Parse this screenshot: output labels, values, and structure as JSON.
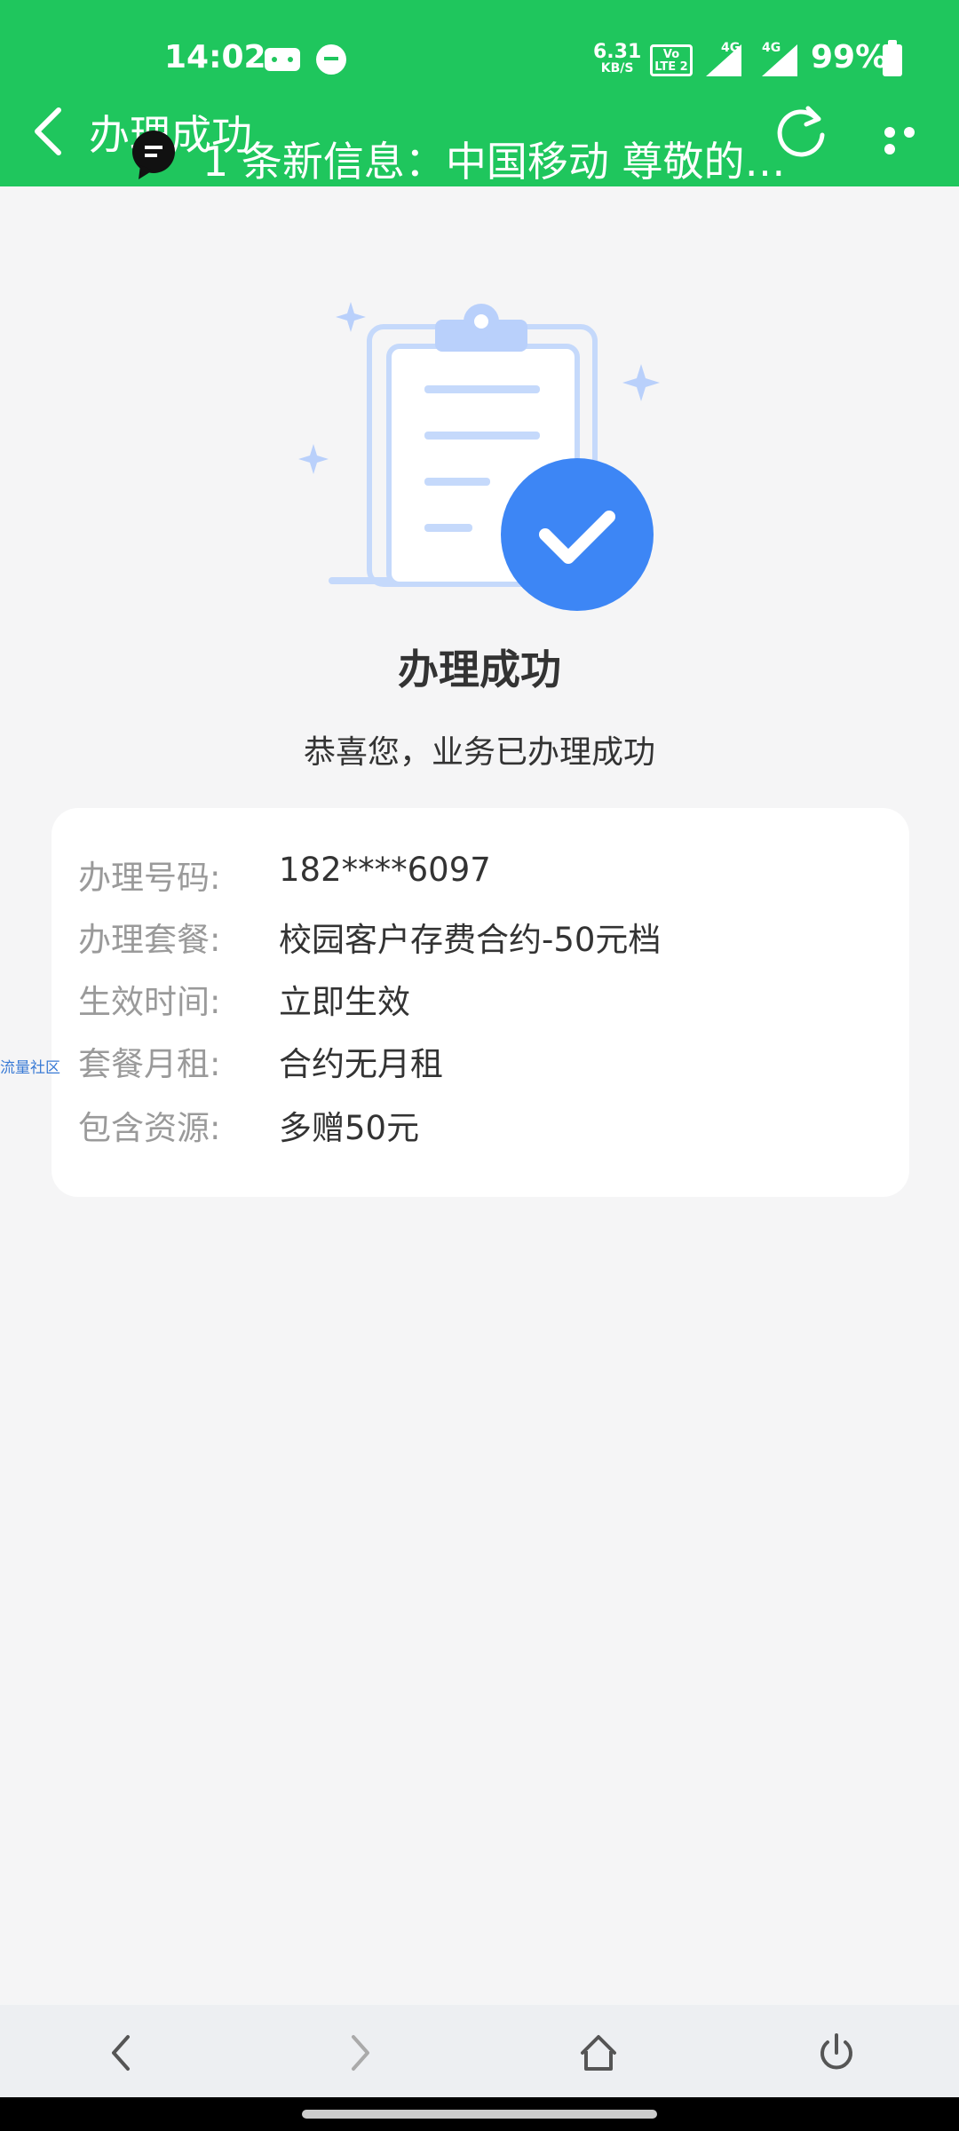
{
  "status_bar": {
    "time": "14:02",
    "net_speed_value": "6.31",
    "net_speed_unit": "KB/S",
    "volte_label": "Vo LTE 2",
    "sim1_label": "4G",
    "sim2_label": "4G",
    "battery_percent": "99%"
  },
  "nav": {
    "title": "办理成功",
    "notification_text": "1 条新信息：中国移动  尊敬的用..."
  },
  "result": {
    "title": "办理成功",
    "subtitle": "恭喜您，业务已办理成功"
  },
  "details": [
    {
      "label": "办理号码:",
      "value": "182****6097"
    },
    {
      "label": "办理套餐:",
      "value": "校园客户存费合约-50元档"
    },
    {
      "label": "生效时间:",
      "value": "立即生效"
    },
    {
      "label": "套餐月租:",
      "value": "合约无月租"
    },
    {
      "label": "包含资源:",
      "value": "多赠50元"
    }
  ],
  "side_tag": "流量社区",
  "colors": {
    "header_green": "#1fc65d",
    "check_blue": "#3d86f5",
    "clipboard_light_blue": "#c5d9fb"
  },
  "icons": {
    "back": "chevron-left-icon",
    "refresh": "refresh-icon",
    "more": "more-dots-icon",
    "notification": "message-bubble-icon",
    "success": "clipboard-check-icon",
    "bottom": [
      "back-arrow-icon",
      "forward-arrow-icon",
      "home-icon",
      "power-icon"
    ]
  }
}
